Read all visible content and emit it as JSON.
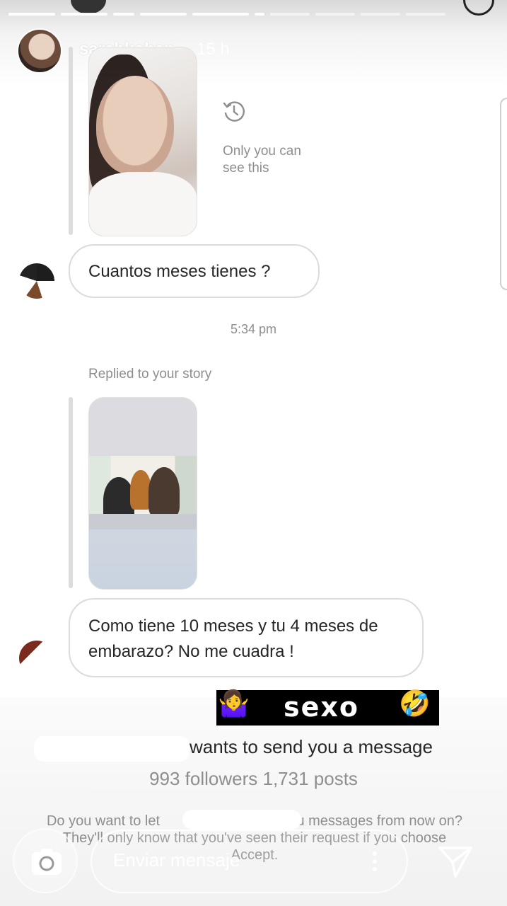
{
  "story_header": {
    "username": "sarahkohan",
    "time_ago": "15 h"
  },
  "chat": {
    "only_you_text": "Only you can see this",
    "message1": "Cuantos meses tienes ?",
    "timestamp": "5:34 pm",
    "replied_label": "Replied to your story",
    "message2": "Como tiene 10 meses y tu 4 meses de embarazo? No me cuadra !"
  },
  "sticker": {
    "text": "sexo",
    "emoji_left": "🤷‍♀️",
    "emoji_right": "🤣"
  },
  "request": {
    "wants_text": "wants to send you a message",
    "counts_text": "993 followers 1,731 posts",
    "question_text": "Do you want to let                          od you messages from now on? They'll only know that you've seen their request if you choose Accept."
  },
  "composer": {
    "placeholder": "Enviar mensaje"
  },
  "icons": {
    "history": "history-icon",
    "camera": "camera-icon",
    "more": "more-vertical-icon",
    "send": "send-icon"
  }
}
